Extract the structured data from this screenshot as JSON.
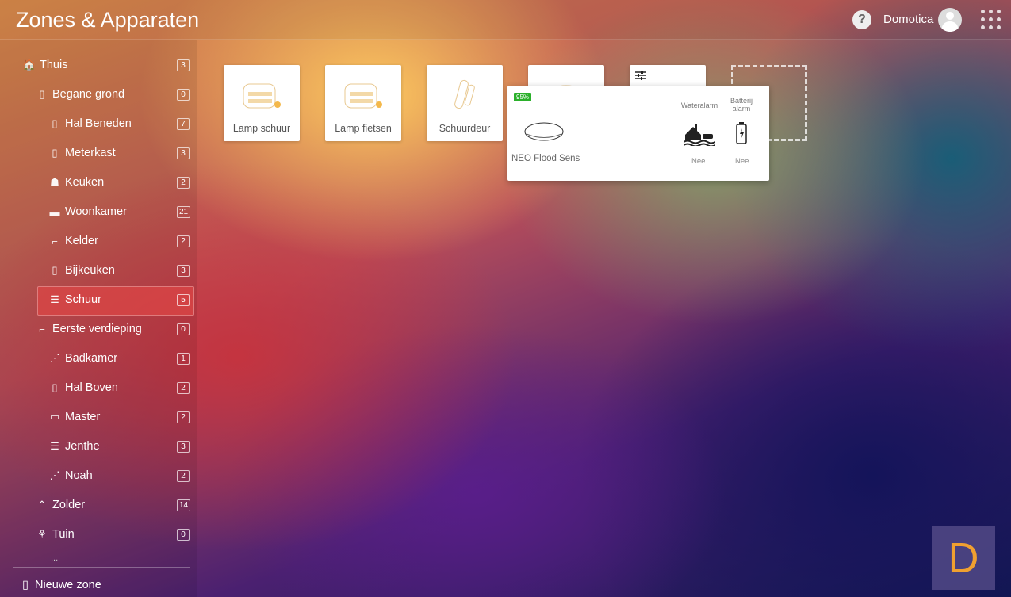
{
  "header": {
    "title": "Zones & Apparaten",
    "help": "?",
    "user": "Domotica"
  },
  "sidebar": {
    "items": [
      {
        "label": "Thuis",
        "count": "3",
        "icon": "home-icon",
        "glyph": "🏠",
        "level": 0
      },
      {
        "label": "Begane grond",
        "count": "0",
        "icon": "door-icon",
        "glyph": "▯",
        "level": 1
      },
      {
        "label": "Hal Beneden",
        "count": "7",
        "icon": "door-icon",
        "glyph": "▯",
        "level": 2
      },
      {
        "label": "Meterkast",
        "count": "3",
        "icon": "door-icon",
        "glyph": "▯",
        "level": 2
      },
      {
        "label": "Keuken",
        "count": "2",
        "icon": "kitchen-icon",
        "glyph": "☗",
        "level": 2
      },
      {
        "label": "Woonkamer",
        "count": "21",
        "icon": "sofa-icon",
        "glyph": "▬",
        "level": 2
      },
      {
        "label": "Kelder",
        "count": "2",
        "icon": "stairs-icon",
        "glyph": "⌐",
        "level": 2
      },
      {
        "label": "Bijkeuken",
        "count": "3",
        "icon": "door-icon",
        "glyph": "▯",
        "level": 2
      },
      {
        "label": "Schuur",
        "count": "5",
        "icon": "shed-icon",
        "glyph": "☰",
        "level": 2,
        "selected": true
      },
      {
        "label": "Eerste verdieping",
        "count": "0",
        "icon": "stairs-icon",
        "glyph": "⌐",
        "level": 1
      },
      {
        "label": "Badkamer",
        "count": "1",
        "icon": "shower-icon",
        "glyph": "⋰",
        "level": 2
      },
      {
        "label": "Hal Boven",
        "count": "2",
        "icon": "door-icon",
        "glyph": "▯",
        "level": 2
      },
      {
        "label": "Master",
        "count": "2",
        "icon": "bed-icon",
        "glyph": "▭",
        "level": 2
      },
      {
        "label": "Jenthe",
        "count": "3",
        "icon": "shed-icon",
        "glyph": "☰",
        "level": 2
      },
      {
        "label": "Noah",
        "count": "2",
        "icon": "shower-icon",
        "glyph": "⋰",
        "level": 2
      },
      {
        "label": "Zolder",
        "count": "14",
        "icon": "roof-icon",
        "glyph": "⌃",
        "level": 1
      },
      {
        "label": "Tuin",
        "count": "0",
        "icon": "tulip-icon",
        "glyph": "⚘",
        "level": 1
      }
    ],
    "more": "...",
    "new_zone": "Nieuwe zone"
  },
  "devices": [
    {
      "label": "Lamp schuur",
      "icon": "dimmer-lamp-icon"
    },
    {
      "label": "Lamp fietsen",
      "icon": "dimmer-lamp-icon"
    },
    {
      "label": "Schuurdeur",
      "icon": "door-sensor-icon"
    },
    {
      "label": "",
      "icon": "flood-sensor-icon"
    },
    {
      "label": "",
      "icon": "settings-sliders-icon"
    }
  ],
  "popup": {
    "battery": "95%",
    "name": "NEO Flood Sensor",
    "water_label": "Wateralarm",
    "water_value": "Nee",
    "battery_label": "Batterij alarm",
    "battery_value": "Nee"
  },
  "logo": "D"
}
